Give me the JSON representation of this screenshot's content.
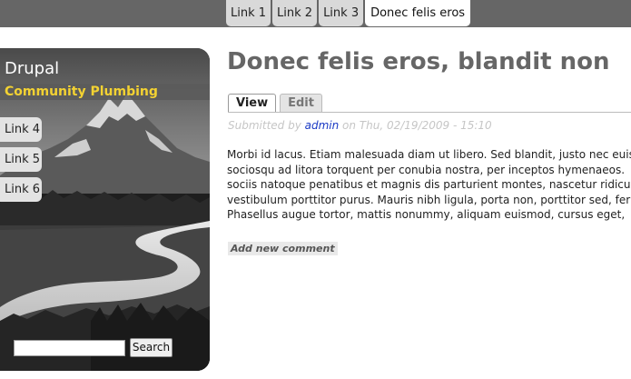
{
  "primary_links": [
    {
      "label": "Link 1",
      "active": false
    },
    {
      "label": "Link 2",
      "active": false
    },
    {
      "label": "Link 3",
      "active": false
    },
    {
      "label": "Donec felis eros",
      "active": true
    }
  ],
  "sidebar": {
    "site_name": "Drupal",
    "slogan": "Community Plumbing",
    "links": [
      "Link 4",
      "Link 5",
      "Link 6"
    ],
    "search": {
      "value": "",
      "button_label": "Search"
    }
  },
  "main": {
    "title": "Donec felis eros, blandit non",
    "tabs": {
      "view": "View",
      "edit": "Edit"
    },
    "submitted": {
      "prefix": "Submitted by ",
      "author": "admin",
      "suffix": " on Thu, 02/19/2009 - 15:10"
    },
    "body_lines": [
      "Morbi id lacus. Etiam malesuada diam ut libero. Sed blandit, justo nec euis",
      "sociosqu ad litora torquent per conubia nostra, per inceptos hymenaeos.",
      "sociis natoque penatibus et magnis dis parturient montes, nascetur ridicul",
      "vestibulum porttitor purus. Mauris nibh ligula, porta non, porttitor sed, fer",
      "Phasellus augue tortor, mattis nonummy, aliquam euismod, cursus eget,"
    ],
    "add_comment": "Add new comment"
  },
  "colors": {
    "topbar": "#666666",
    "slogan": "#f3d232",
    "title": "#666666",
    "link": "#1a39c4"
  }
}
